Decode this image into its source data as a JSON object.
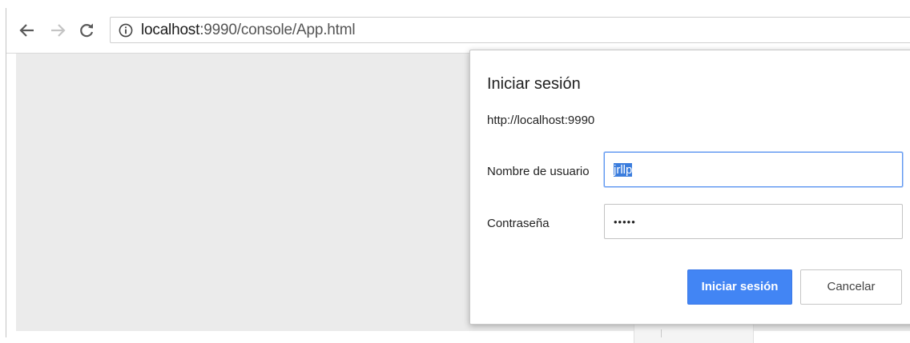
{
  "browser": {
    "url_host": "localhost",
    "url_rest": ":9990/console/App.html",
    "icons": {
      "back": "arrow-left-icon",
      "forward": "arrow-right-icon",
      "reload": "reload-icon",
      "info": "info-icon"
    }
  },
  "dialog": {
    "title": "Iniciar sesión",
    "origin": "http://localhost:9990",
    "username_label": "Nombre de usuario",
    "username_value": "jrllp",
    "password_label": "Contraseña",
    "password_value": "jrllp",
    "submit_label": "Iniciar sesión",
    "cancel_label": "Cancelar"
  },
  "colors": {
    "accent": "#4285f4",
    "page_background": "#ebebeb",
    "dialog_background": "#ffffff"
  }
}
